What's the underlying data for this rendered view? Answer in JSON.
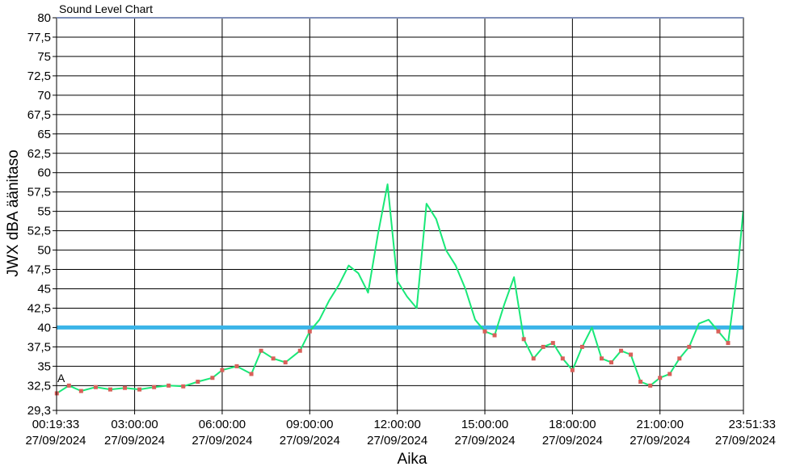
{
  "chart_data": {
    "type": "line",
    "title": "Sound Level Chart",
    "xlabel": "Aika",
    "ylabel": "JWX dBA äänitaso",
    "ylim": [
      29.3,
      80
    ],
    "y_ticks": [
      "29,3",
      "32,5",
      "35",
      "37,5",
      "40",
      "42,5",
      "45",
      "47,5",
      "50",
      "52,5",
      "55",
      "57,5",
      "60",
      "62,5",
      "65",
      "67,5",
      "70",
      "72,5",
      "75",
      "77,5",
      "80"
    ],
    "xlim": [
      "00:19:33",
      "23:51:33"
    ],
    "x_ticks": [
      {
        "time": "00:19:33",
        "date": "27/09/2024"
      },
      {
        "time": "03:00:00",
        "date": "27/09/2024"
      },
      {
        "time": "06:00:00",
        "date": "27/09/2024"
      },
      {
        "time": "09:00:00",
        "date": "27/09/2024"
      },
      {
        "time": "12:00:00",
        "date": "27/09/2024"
      },
      {
        "time": "15:00:00",
        "date": "27/09/2024"
      },
      {
        "time": "18:00:00",
        "date": "27/09/2024"
      },
      {
        "time": "21:00:00",
        "date": "27/09/2024"
      },
      {
        "time": "23:51:33",
        "date": "27/09/2024"
      }
    ],
    "grid": true,
    "threshold": {
      "value": 40,
      "color": "#3bb4e8"
    },
    "annotation": "A",
    "series": [
      {
        "color": "#19e878",
        "marker_color": "#d9605a",
        "x": [
          "00:20",
          "00:45",
          "01:10",
          "01:40",
          "02:10",
          "02:40",
          "03:10",
          "03:40",
          "04:10",
          "04:40",
          "05:10",
          "05:40",
          "06:00",
          "06:30",
          "07:00",
          "07:20",
          "07:45",
          "08:10",
          "08:40",
          "09:00",
          "09:20",
          "09:40",
          "10:00",
          "10:20",
          "10:40",
          "11:00",
          "11:20",
          "11:40",
          "12:00",
          "12:20",
          "12:40",
          "13:00",
          "13:20",
          "13:40",
          "14:00",
          "14:20",
          "14:40",
          "15:00",
          "15:20",
          "15:40",
          "16:00",
          "16:20",
          "16:40",
          "17:00",
          "17:20",
          "17:40",
          "18:00",
          "18:20",
          "18:40",
          "19:00",
          "19:20",
          "19:40",
          "20:00",
          "20:20",
          "20:40",
          "21:00",
          "21:20",
          "21:40",
          "22:00",
          "22:20",
          "22:40",
          "23:00",
          "23:20",
          "23:40",
          "23:51"
        ],
        "values": [
          31.5,
          32.5,
          31.8,
          32.3,
          32.0,
          32.2,
          32.0,
          32.3,
          32.5,
          32.4,
          33.0,
          33.5,
          34.5,
          35.0,
          34.0,
          37.0,
          36.0,
          35.5,
          37.0,
          39.5,
          41.0,
          43.5,
          45.5,
          48.0,
          47.0,
          44.5,
          52.0,
          58.5,
          46.0,
          44.0,
          42.5,
          56.0,
          54.0,
          50.0,
          48.0,
          45.0,
          41.0,
          39.5,
          39.0,
          43.0,
          46.5,
          38.5,
          36.0,
          37.5,
          38.0,
          36.0,
          34.5,
          37.5,
          40.0,
          36.0,
          35.5,
          37.0,
          36.5,
          33.0,
          32.5,
          33.5,
          34.0,
          36.0,
          37.5,
          40.5,
          41.0,
          39.5,
          38.0,
          47.5,
          55.0
        ]
      }
    ]
  }
}
